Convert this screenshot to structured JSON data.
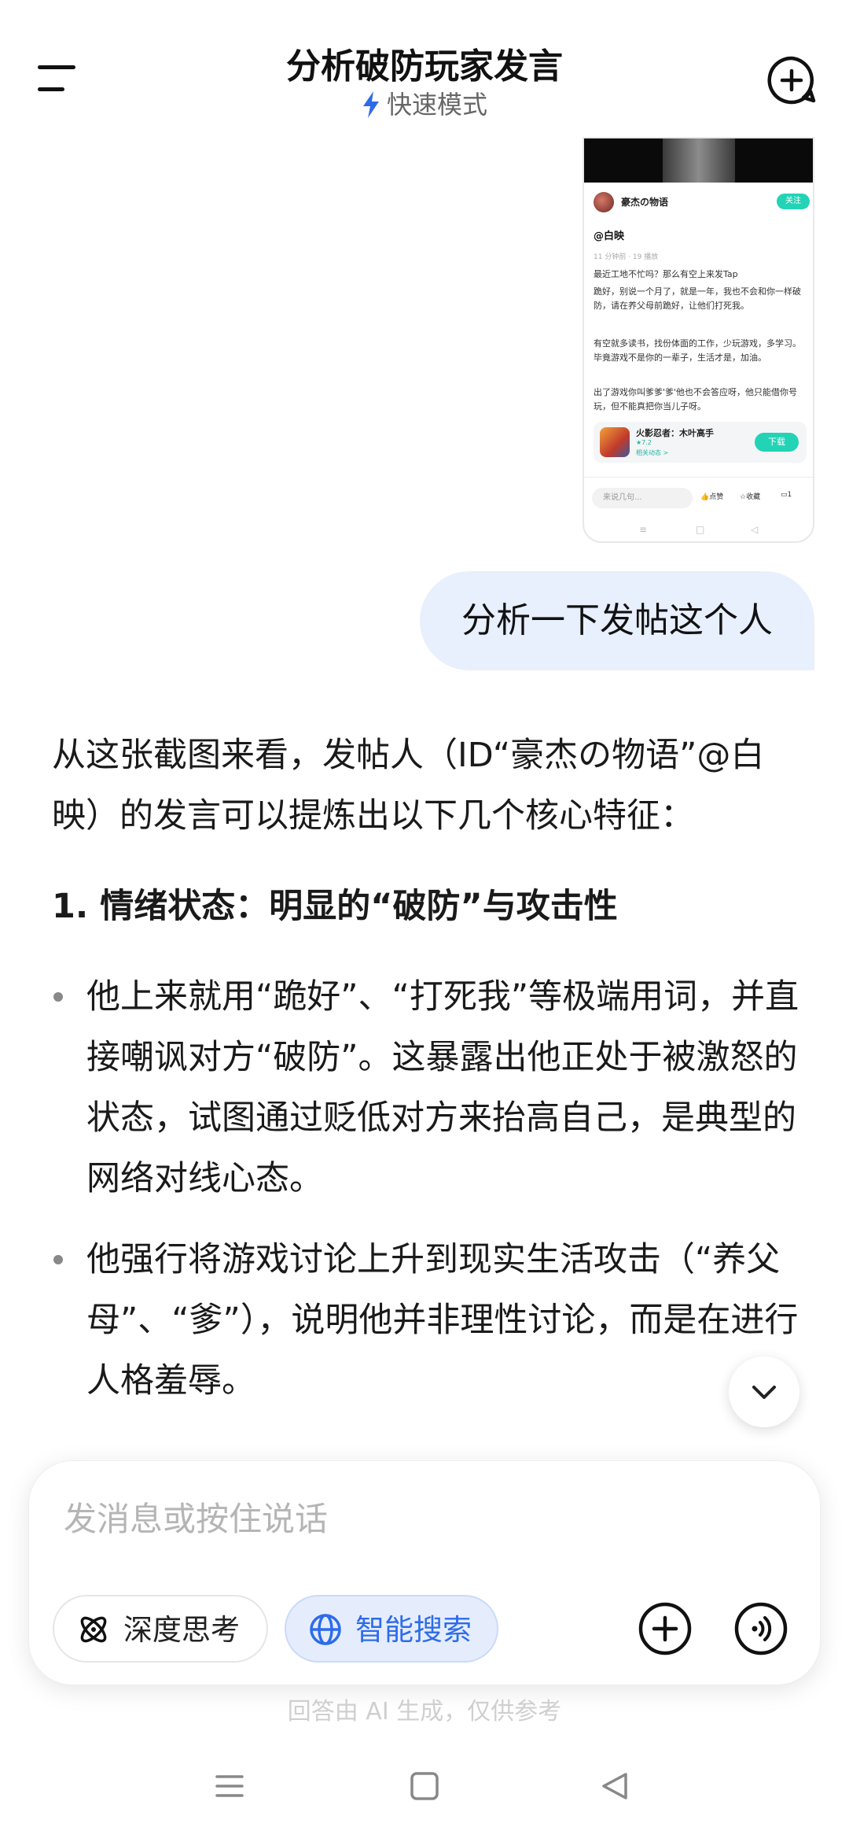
{
  "header": {
    "title": "分析破防玩家发言",
    "mode": "快速模式"
  },
  "attachment": {
    "username": "豪杰の物语",
    "follow": "关注",
    "handle": "@白映",
    "meta": "11 分钟前 · 19 播放",
    "line1": "最近工地不忙吗？那么有空上来发Tap",
    "line2": "跪好，别说一个月了，就是一年，我也不会和你一样破防，请在养父母前跪好，让他们打死我。",
    "line3": "有空就多读书，找份体面的工作，少玩游戏，多学习。毕竟游戏不是你的一辈子，生活才是，加油。",
    "line4": "出了游戏你叫爹爹'爹'他也不会答应呀，他只能借你号玩，但不能真把你当儿子呀。",
    "game_name": "火影忍者：木叶高手",
    "game_rating": "★7.2",
    "game_link": "相关动态 >",
    "download": "下载",
    "reply_placeholder": "来说几句...",
    "like": "点赞",
    "favorite": "收藏",
    "comments": "1"
  },
  "user_message": "分析一下发帖这个人",
  "answer": {
    "intro": "从这张截图来看，发帖人（ID“豪杰の物语”@白映）的发言可以提炼出以下几个核心特征：",
    "heading1": "1. 情绪状态：明显的“破防”与攻击性",
    "bullets": [
      "他上来就用“跪好”、“打死我”等极端用词，并直接嘲讽对方“破防”。这暴露出他正处于被激怒的状态，试图通过贬低对方来抬高自己，是典型的网络对线心态。",
      "他强行将游戏讨论上升到现实生活攻击（“养父母”、“爹”），说明他并非理性讨论，而是在进行人格羞辱。"
    ]
  },
  "composer": {
    "placeholder": "发消息或按住说话",
    "deep_think": "深度思考",
    "smart_search": "智能搜索"
  },
  "disclaimer": "回答由 AI 生成，仅供参考",
  "colors": {
    "accent": "#2e6bea",
    "bubble": "#e8effd",
    "teal": "#22d3b6"
  }
}
